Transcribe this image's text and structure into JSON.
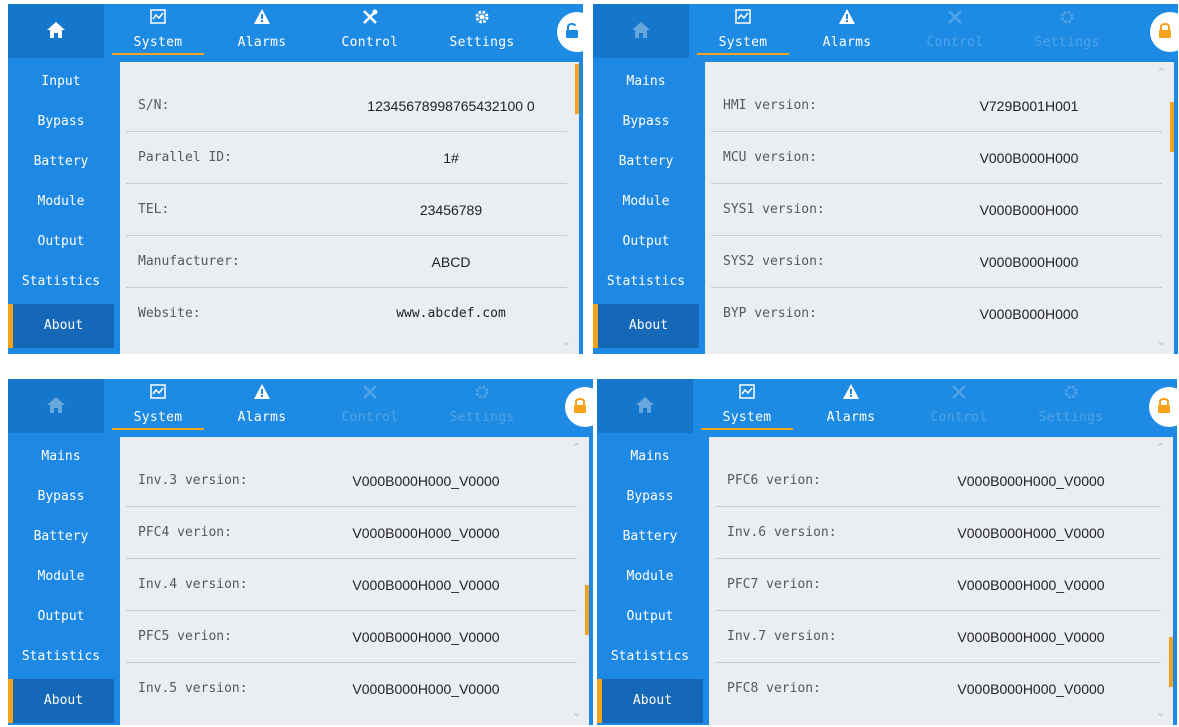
{
  "colors": {
    "accent": "#f7a21b",
    "nav_blue": "#1d8ae3",
    "content_bg": "#eaedf1"
  },
  "icons": {
    "home": "home-icon",
    "system": "system-chart-icon",
    "alarms": "alarm-warning-icon",
    "control": "control-tools-icon",
    "settings": "gear-icon",
    "lock": "lock-icon"
  },
  "panels": [
    {
      "tabs": {
        "system": "System",
        "alarms": "Alarms",
        "control": "Control",
        "settings": "Settings"
      },
      "sidebar": [
        "Input",
        "Bypass",
        "Battery",
        "Module",
        "Output",
        "Statistics",
        "About"
      ],
      "rows": [
        {
          "label": "S/N:",
          "value": "12345678998765432100 0"
        },
        {
          "label": "Parallel ID:",
          "value": "1#"
        },
        {
          "label": "TEL:",
          "value": "23456789"
        },
        {
          "label": "Manufacturer:",
          "value": "ABCD"
        },
        {
          "label": "Website:",
          "value": "www.abcdef.com"
        }
      ]
    },
    {
      "tabs": {
        "system": "System",
        "alarms": "Alarms",
        "control": "Control",
        "settings": "Settings"
      },
      "sidebar": [
        "Mains",
        "Bypass",
        "Battery",
        "Module",
        "Output",
        "Statistics",
        "About"
      ],
      "rows": [
        {
          "label": "HMI version:",
          "value": "V729B001H001"
        },
        {
          "label": "MCU version:",
          "value": "V000B000H000"
        },
        {
          "label": "SYS1 version:",
          "value": "V000B000H000"
        },
        {
          "label": "SYS2 version:",
          "value": "V000B000H000"
        },
        {
          "label": "BYP version:",
          "value": "V000B000H000"
        }
      ]
    },
    {
      "tabs": {
        "system": "System",
        "alarms": "Alarms",
        "control": "Control",
        "settings": "Settings"
      },
      "sidebar": [
        "Mains",
        "Bypass",
        "Battery",
        "Module",
        "Output",
        "Statistics",
        "About"
      ],
      "rows": [
        {
          "label": "Inv.3 version:",
          "value": "V000B000H000_V0000"
        },
        {
          "label": "PFC4 verion:",
          "value": "V000B000H000_V0000"
        },
        {
          "label": "Inv.4 version:",
          "value": "V000B000H000_V0000"
        },
        {
          "label": "PFC5 verion:",
          "value": "V000B000H000_V0000"
        },
        {
          "label": "Inv.5 version:",
          "value": "V000B000H000_V0000"
        }
      ]
    },
    {
      "tabs": {
        "system": "System",
        "alarms": "Alarms",
        "control": "Control",
        "settings": "Settings"
      },
      "sidebar": [
        "Mains",
        "Bypass",
        "Battery",
        "Module",
        "Output",
        "Statistics",
        "About"
      ],
      "rows": [
        {
          "label": "PFC6 verion:",
          "value": "V000B000H000_V0000"
        },
        {
          "label": "Inv.6 version:",
          "value": "V000B000H000_V0000"
        },
        {
          "label": "PFC7 verion:",
          "value": "V000B000H000_V0000"
        },
        {
          "label": "Inv.7 version:",
          "value": "V000B000H000_V0000"
        },
        {
          "label": "PFC8 verion:",
          "value": "V000B000H000_V0000"
        }
      ]
    }
  ]
}
